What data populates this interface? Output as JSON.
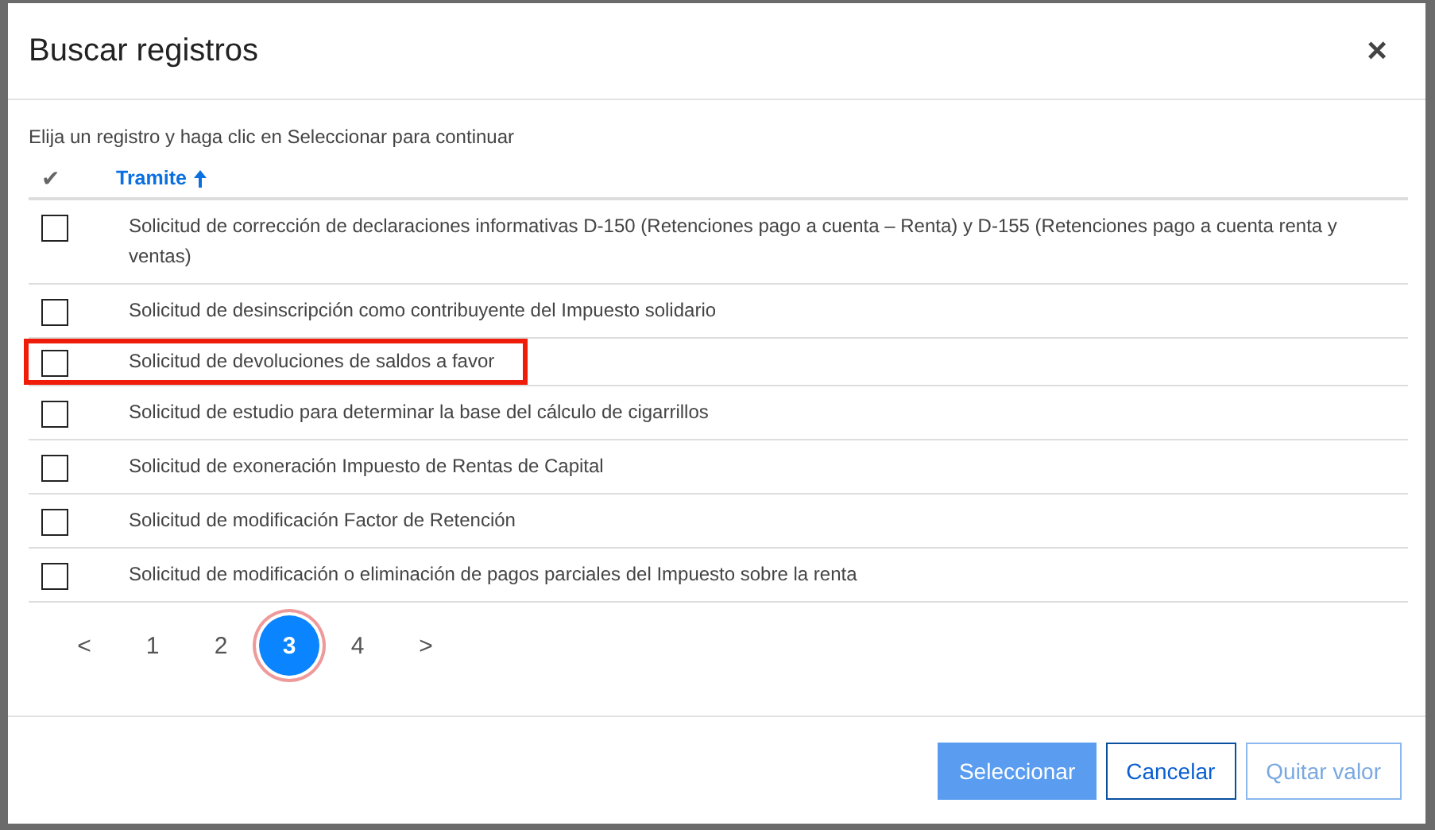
{
  "dialog": {
    "title": "Buscar registros",
    "close": "×"
  },
  "instructions": "Elija un registro y haga clic en Seleccionar para continuar",
  "table": {
    "check_header": "✔",
    "columns": [
      {
        "label": "Tramite",
        "sorted_ascending": true
      }
    ],
    "rows": [
      {
        "tramite": "Solicitud de corrección de declaraciones informativas D-150 (Retenciones pago a cuenta – Renta) y D-155 (Retenciones pago a cuenta renta y ventas)",
        "checked": false,
        "highlighted": false
      },
      {
        "tramite": "Solicitud de desinscripción como contribuyente del Impuesto solidario",
        "checked": false,
        "highlighted": false
      },
      {
        "tramite": "Solicitud de devoluciones de saldos a favor",
        "checked": false,
        "highlighted": true
      },
      {
        "tramite": "Solicitud de estudio para determinar la base del cálculo de cigarrillos",
        "checked": false,
        "highlighted": false
      },
      {
        "tramite": "Solicitud de exoneración Impuesto de Rentas de Capital",
        "checked": false,
        "highlighted": false
      },
      {
        "tramite": "Solicitud de modificación Factor de Retención",
        "checked": false,
        "highlighted": false
      },
      {
        "tramite": "Solicitud de modificación o eliminación de pagos parciales del Impuesto sobre la renta",
        "checked": false,
        "highlighted": false
      }
    ]
  },
  "pagination": {
    "prev": "<",
    "next": ">",
    "pages": [
      {
        "label": "1",
        "selected": false
      },
      {
        "label": "2",
        "selected": false
      },
      {
        "label": "3",
        "selected": true
      },
      {
        "label": "4",
        "selected": false
      }
    ]
  },
  "buttons": [
    {
      "label": "Seleccionar",
      "kind": "primary"
    },
    {
      "label": "Cancelar",
      "kind": "outline"
    },
    {
      "label": "Quitar valor",
      "kind": "muted"
    }
  ]
}
